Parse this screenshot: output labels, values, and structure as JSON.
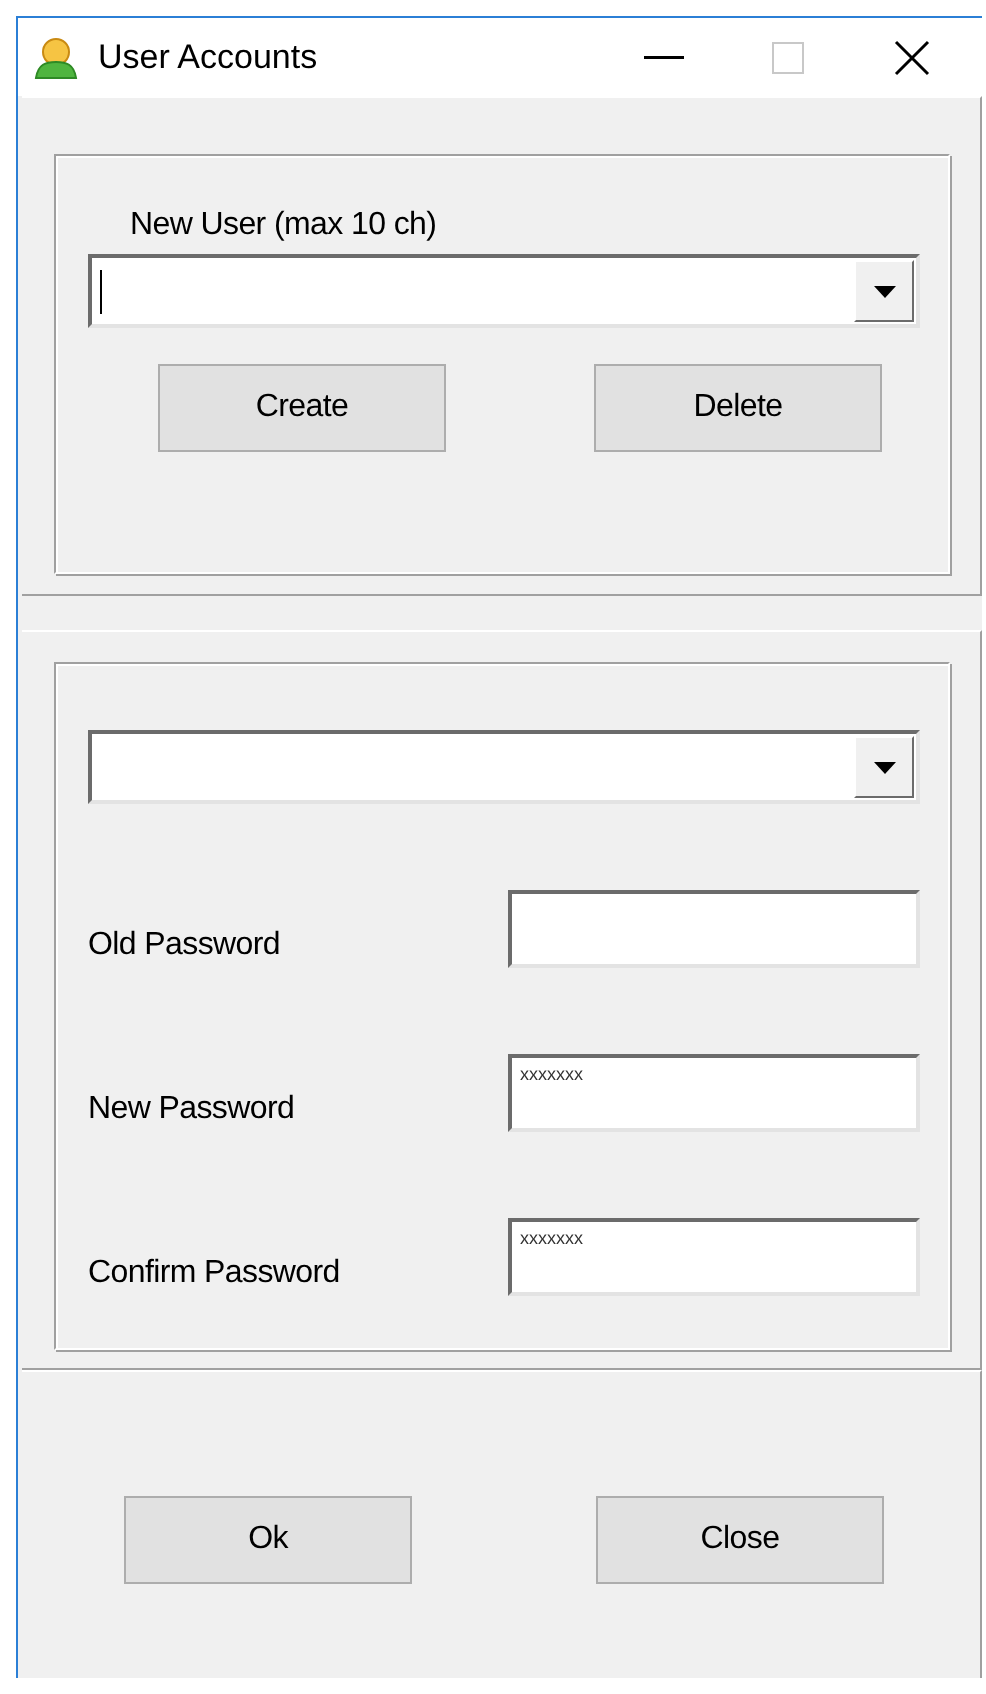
{
  "window": {
    "title": "User Accounts"
  },
  "new_user": {
    "label": "New User (max 10 ch)",
    "focused": true,
    "buttons": [
      "Create",
      "Delete"
    ]
  },
  "account": {
    "fields": [
      {
        "label": "Old Password"
      },
      {
        "label": "New Password",
        "value": "xxxxxxx"
      },
      {
        "label": "Confirm Password",
        "value": "xxxxxxx"
      }
    ]
  },
  "buttons": [
    "Ok",
    "Close"
  ]
}
